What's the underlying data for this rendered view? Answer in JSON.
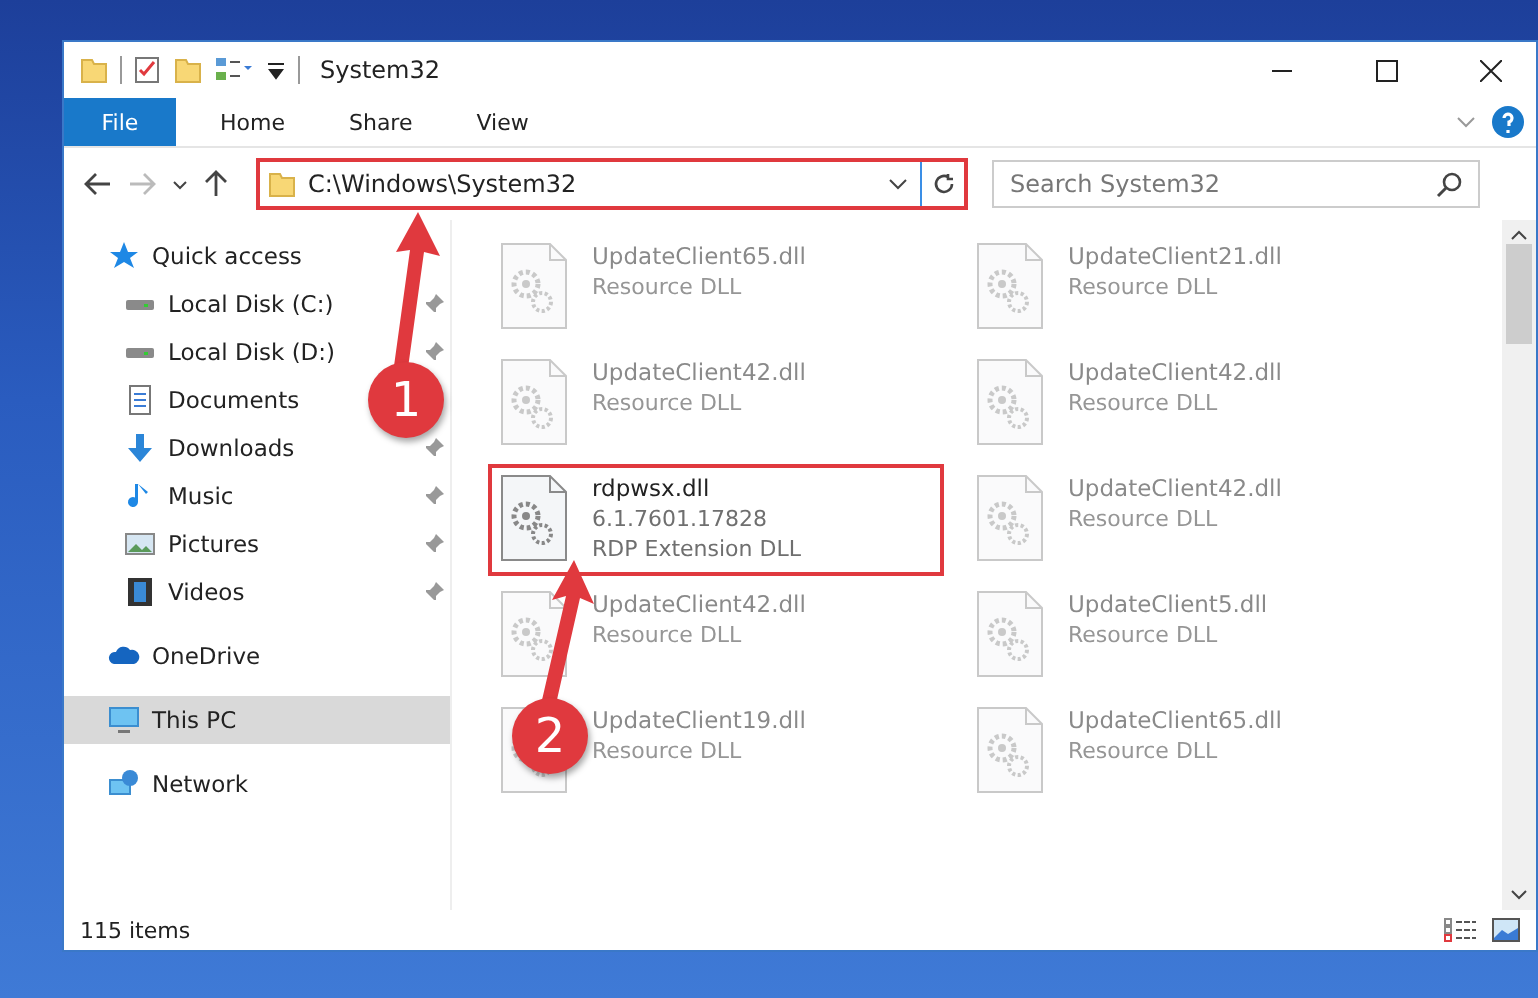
{
  "window": {
    "title": "System32"
  },
  "ribbon": {
    "tabs": [
      {
        "label": "File",
        "selected": true
      },
      {
        "label": "Home",
        "selected": false
      },
      {
        "label": "Share",
        "selected": false
      },
      {
        "label": "View",
        "selected": false
      }
    ]
  },
  "address_bar": {
    "path": "C:\\Windows\\System32",
    "highlighted": true
  },
  "search": {
    "placeholder": "Search System32"
  },
  "sidebar": {
    "items": [
      {
        "label": "Quick access",
        "pinned": false,
        "selected": false,
        "children": [
          {
            "label": "Local Disk (C:)",
            "pinned": true,
            "selected": false
          },
          {
            "label": "Local Disk (D:)",
            "pinned": true,
            "selected": false
          },
          {
            "label": "Documents",
            "pinned": false,
            "selected": false
          },
          {
            "label": "Downloads",
            "pinned": true,
            "selected": false
          },
          {
            "label": "Music",
            "pinned": true,
            "selected": false
          },
          {
            "label": "Pictures",
            "pinned": true,
            "selected": false
          },
          {
            "label": "Videos",
            "pinned": true,
            "selected": false
          }
        ]
      },
      {
        "label": "OneDrive",
        "pinned": false,
        "selected": false
      },
      {
        "label": "This PC",
        "pinned": false,
        "selected": true
      },
      {
        "label": "Network",
        "pinned": false,
        "selected": false
      }
    ]
  },
  "files": [
    {
      "name": "UpdateClient65.dll",
      "detail": "Resource DLL",
      "blurred": true,
      "highlighted": false
    },
    {
      "name": "UpdateClient21.dll",
      "detail": "Resource DLL",
      "blurred": true,
      "highlighted": false
    },
    {
      "name": "UpdateClient42.dll",
      "detail": "Resource DLL",
      "blurred": true,
      "highlighted": false
    },
    {
      "name": "UpdateClient42.dll",
      "detail": "Resource DLL",
      "blurred": true,
      "highlighted": false
    },
    {
      "name": "rdpwsx.dll",
      "version": "6.1.7601.17828",
      "detail": "RDP Extension DLL",
      "blurred": false,
      "highlighted": true
    },
    {
      "name": "UpdateClient42.dll",
      "detail": "Resource DLL",
      "blurred": true,
      "highlighted": false
    },
    {
      "name": "UpdateClient42.dll",
      "detail": "Resource DLL",
      "blurred": true,
      "highlighted": false
    },
    {
      "name": "UpdateClient5.dll",
      "detail": "Resource DLL",
      "blurred": true,
      "highlighted": false
    },
    {
      "name": "UpdateClient19.dll",
      "detail": "Resource DLL",
      "blurred": true,
      "highlighted": false
    },
    {
      "name": "UpdateClient65.dll",
      "detail": "Resource DLL",
      "blurred": true,
      "highlighted": false
    }
  ],
  "status_bar": {
    "item_count": "115 items"
  },
  "annotations": [
    {
      "label": "1"
    },
    {
      "label": "2"
    }
  ]
}
